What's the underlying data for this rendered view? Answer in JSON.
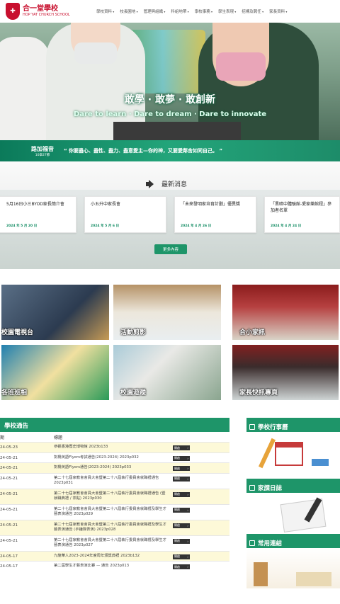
{
  "header": {
    "logo_icon": "school-crest-icon",
    "school_name_cn": "合一堂學校",
    "school_name_en": "HOP YAT CHURCH SCHOOL",
    "nav": [
      "學校資料",
      "校長園地",
      "管理與組織",
      "科組地帶",
      "學校事務",
      "學生表現",
      "招標及聘任",
      "家長資料"
    ]
  },
  "hero": {
    "slogan_cn": "敢學 · 敢夢 · 敢創新",
    "slogan_en": "Dare to learn · Dare to dream · Dare to innovate"
  },
  "verse": {
    "book": "路加福音",
    "chapter": "10章27節",
    "text": "“ 你要盡心、盡性、盡力、盡意愛主—你的神，又要愛鄰舍如同自己。 ”"
  },
  "news": {
    "title": "最新消息",
    "icon": "speaker-icon",
    "items": [
      {
        "title": "5月16日小三BYOD家長簡介會",
        "date": "2024 年 5 月 20 日"
      },
      {
        "title": "小五升中家長會",
        "date": "2024 年 5 月 6 日"
      },
      {
        "title": "「未來發明家培育計劃」優異獎",
        "date": "2024 年 4 月 26 日"
      },
      {
        "title": "「黑暗中體驗館-愛家樂館程」參加者名單",
        "date": "2024 年 4 月 24 日"
      }
    ],
    "more_label": "更多內容"
  },
  "tiles": [
    "校園電視台",
    "活動剪影",
    "合小家訊",
    "各班班相",
    "校園遊蹤",
    "家長快訊專頁"
  ],
  "notices": {
    "title": "學校通告",
    "col_date": "期",
    "col_title": "標題",
    "btn_label": "開啟",
    "rows": [
      {
        "date": "24-05-23",
        "title": "參觀香港歷史博物館 2023b133"
      },
      {
        "date": "24-05-21",
        "title": "劍橋英語Flyers考試通告(2023-2024) 2023p032"
      },
      {
        "date": "24-05-21",
        "title": "劍橋英語Flyers通告(2023-2024) 2023p033"
      },
      {
        "date": "24-05-21",
        "title": "第二十七屆家教會會員大會暨第二十八屆執行委員會就職禮通告 2023p031"
      },
      {
        "date": "24-05-21",
        "title": "第二十七屆家教會會員大會暨第二十八屆執行委員會就職禮通告 (暨就職典禮 / 茶點) 2023p030"
      },
      {
        "date": "24-05-21",
        "title": "第二十七屆家教會會員大會暨第二十八屆執行委員會就職禮及學生才藝表演通告 2023p029"
      },
      {
        "date": "24-05-21",
        "title": "第二十七屆家教會會員大會暨第二十八屆執行委員會就職禮及學生才藝表演通告 (手鐘隊表演) 2023p028"
      },
      {
        "date": "24-05-21",
        "title": "第二十七屆家教會會員大會暨第二十八屆執行委員會就職禮及學生才藝表演通告 2023p027"
      },
      {
        "date": "24-05-17",
        "title": "九龍華人2023-2024年度周年頒獎典禮 2023b132"
      },
      {
        "date": "24-05-17",
        "title": "第二屆學生才藝表演比賽 — 通告 2023p013"
      }
    ]
  },
  "side": [
    {
      "title": "學校行事曆",
      "icon": "calendar-icon"
    },
    {
      "title": "家課日誌",
      "icon": "notebook-icon"
    },
    {
      "title": "常用連結",
      "icon": "link-icon"
    }
  ],
  "colors": {
    "brand_red": "#c8102e",
    "brand_green": "#1e9569"
  }
}
